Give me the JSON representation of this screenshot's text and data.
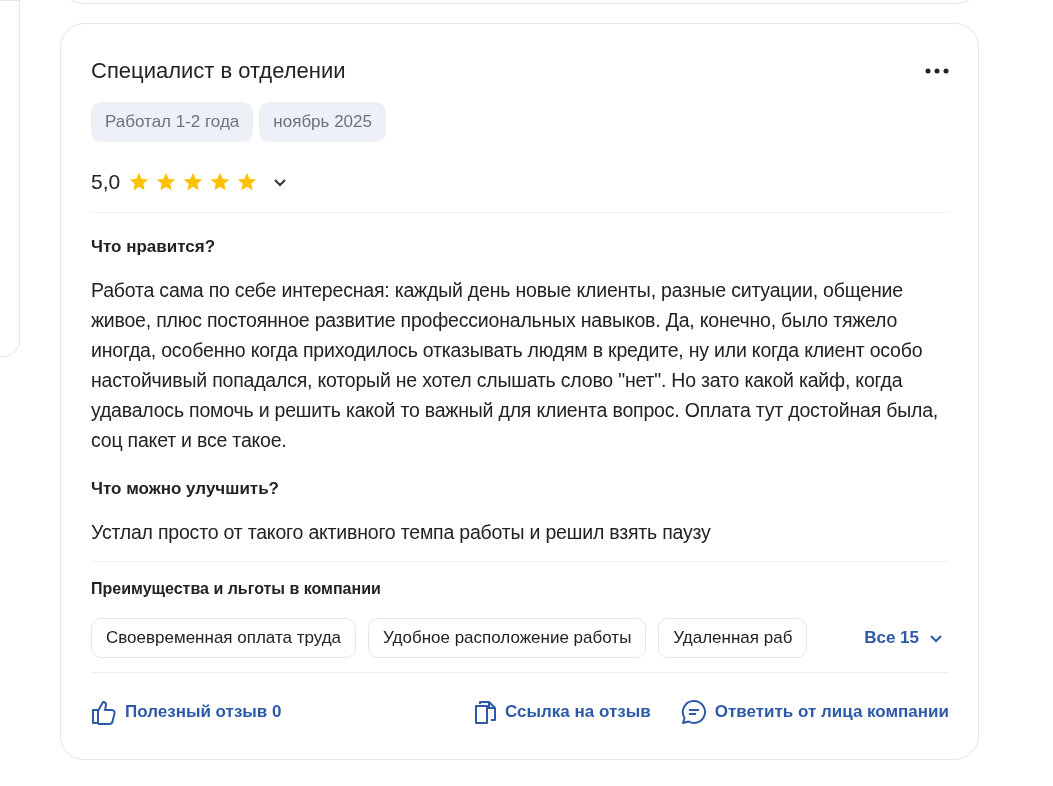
{
  "review": {
    "title": "Специалист в отделении",
    "tags": [
      "Работал 1-2 года",
      "ноябрь 2025"
    ],
    "rating": "5,0",
    "stars": 5,
    "sections": [
      {
        "heading": "Что нравится?",
        "text": "Работа сама по себе интересная: каждый день новые клиенты, разные ситуации, общение живое, плюс постоянное развитие профессиональных навыков. Да, конечно, было тяжело иногда, особенно когда приходилось отказывать людям в кредите, ну или когда клиент особо настойчивый попадался, который не хотел слышать слово \"нет\". Но зато какой кайф, когда удавалось помочь и решить какой то важный для клиента вопрос. Оплата тут достойная была, соц пакет и все такое."
      },
      {
        "heading": "Что можно улучшить?",
        "text": "Устлал просто от такого активного темпа работы и решил взять паузу"
      }
    ],
    "benefits": {
      "heading": "Преимущества и льготы в компании",
      "items": [
        "Своевременная оплата труда",
        "Удобное расположение работы",
        "Удаленная раб"
      ],
      "more": "Все 15"
    },
    "actions": {
      "helpful": "Полезный отзыв 0",
      "link": "Ссылка на отзыв",
      "reply": "Ответить от лица компании"
    }
  }
}
